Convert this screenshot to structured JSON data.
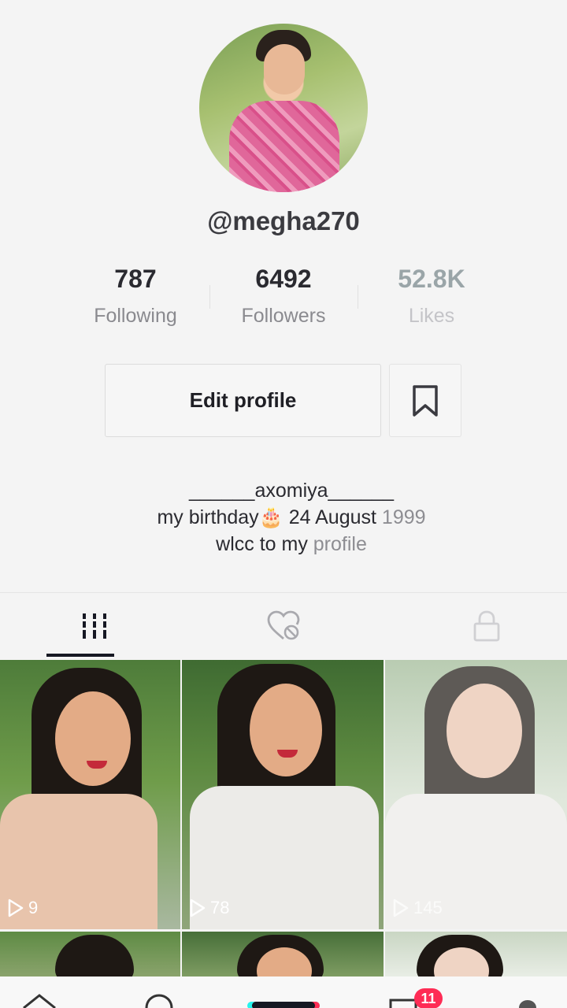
{
  "profile": {
    "username": "@megha270",
    "stats": [
      {
        "value": "787",
        "label": "Following"
      },
      {
        "value": "6492",
        "label": "Followers"
      },
      {
        "value": "52.8K",
        "label": "Likes"
      }
    ],
    "edit_button": "Edit profile",
    "bio_line1": "______axomiya______",
    "bio_line2_text": "my birthday",
    "bio_line2_emoji": "🎂",
    "bio_line2_date": " 24 August",
    "bio_line2_year": " 1999",
    "bio_line3_a": "wlcc to my ",
    "bio_line3_b": "profile"
  },
  "tabs": [
    {
      "icon": "grid-icon"
    },
    {
      "icon": "liked-hidden-icon"
    },
    {
      "icon": "lock-icon"
    }
  ],
  "videos": [
    {
      "views": "9"
    },
    {
      "views": "78"
    },
    {
      "views": "145"
    }
  ],
  "bottom_nav": {
    "inbox_badge": "11"
  },
  "colors": {
    "accent": "#fe2c55",
    "text": "#161823"
  }
}
